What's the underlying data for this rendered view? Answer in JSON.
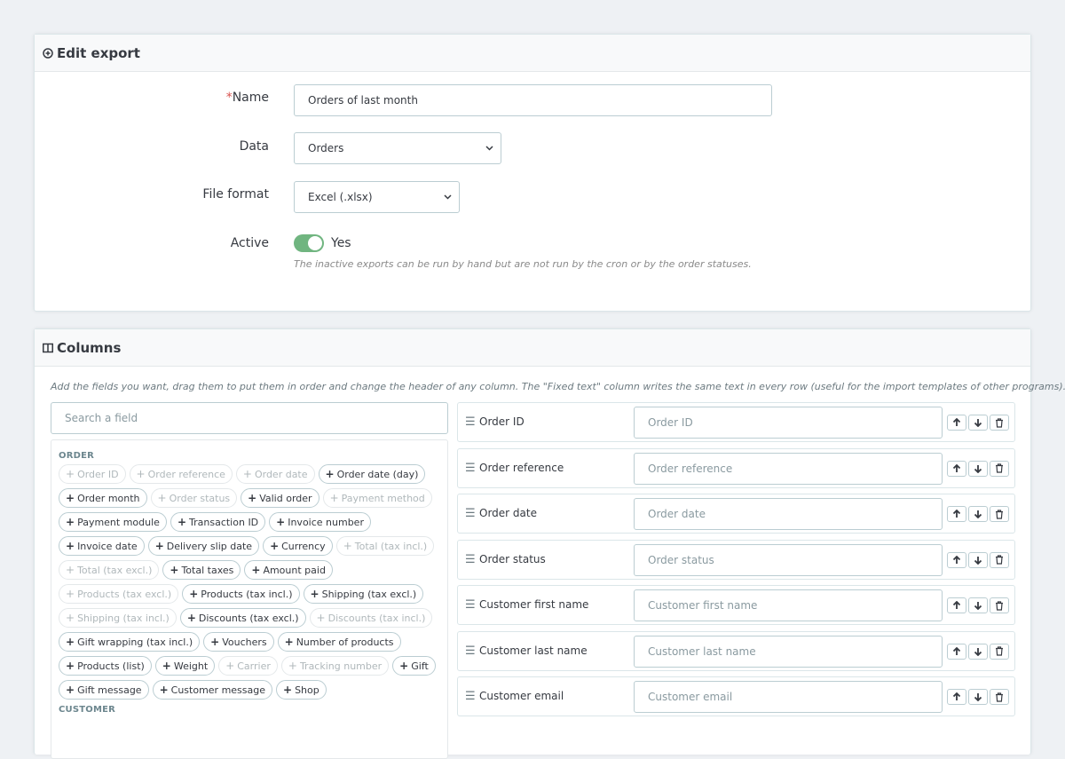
{
  "edit_panel": {
    "title": "Edit export",
    "name_label": "Name",
    "name_required_mark": "*",
    "name_value": "Orders of last month",
    "data_label": "Data",
    "data_value": "Orders",
    "format_label": "File format",
    "format_value": "Excel (.xlsx)",
    "active_label": "Active",
    "active_state": "Yes",
    "active_help": "The inactive exports can be run by hand but are not run by the cron or by the order statuses."
  },
  "columns_panel": {
    "title": "Columns",
    "help": "Add the fields you want, drag them to put them in order and change the header of any column. The \"Fixed text\" column writes the same text in every row (useful for the import templates of other programs).",
    "search_placeholder": "Search a field",
    "groups": [
      {
        "name": "ORDER",
        "fields": [
          {
            "label": "Order ID",
            "used": true
          },
          {
            "label": "Order reference",
            "used": true
          },
          {
            "label": "Order date",
            "used": true
          },
          {
            "label": "Order date (day)",
            "used": false
          },
          {
            "label": "Order month",
            "used": false
          },
          {
            "label": "Order status",
            "used": true
          },
          {
            "label": "Valid order",
            "used": false
          },
          {
            "label": "Payment method",
            "used": true
          },
          {
            "label": "Payment module",
            "used": false
          },
          {
            "label": "Transaction ID",
            "used": false
          },
          {
            "label": "Invoice number",
            "used": false
          },
          {
            "label": "Invoice date",
            "used": false
          },
          {
            "label": "Delivery slip date",
            "used": false
          },
          {
            "label": "Currency",
            "used": false
          },
          {
            "label": "Total (tax incl.)",
            "used": true
          },
          {
            "label": "Total (tax excl.)",
            "used": true
          },
          {
            "label": "Total taxes",
            "used": false
          },
          {
            "label": "Amount paid",
            "used": false
          },
          {
            "label": "Products (tax excl.)",
            "used": true
          },
          {
            "label": "Products (tax incl.)",
            "used": false
          },
          {
            "label": "Shipping (tax excl.)",
            "used": false
          },
          {
            "label": "Shipping (tax incl.)",
            "used": true
          },
          {
            "label": "Discounts (tax excl.)",
            "used": false
          },
          {
            "label": "Discounts (tax incl.)",
            "used": true
          },
          {
            "label": "Gift wrapping (tax incl.)",
            "used": false
          },
          {
            "label": "Vouchers",
            "used": false
          },
          {
            "label": "Number of products",
            "used": false
          },
          {
            "label": "Products (list)",
            "used": false
          },
          {
            "label": "Weight",
            "used": false
          },
          {
            "label": "Carrier",
            "used": true
          },
          {
            "label": "Tracking number",
            "used": true
          },
          {
            "label": "Gift",
            "used": false
          },
          {
            "label": "Gift message",
            "used": false
          },
          {
            "label": "Customer message",
            "used": false
          },
          {
            "label": "Shop",
            "used": false
          }
        ]
      },
      {
        "name": "CUSTOMER",
        "fields": []
      }
    ],
    "columns": [
      {
        "name": "Order ID",
        "placeholder": "Order ID"
      },
      {
        "name": "Order reference",
        "placeholder": "Order reference"
      },
      {
        "name": "Order date",
        "placeholder": "Order date"
      },
      {
        "name": "Order status",
        "placeholder": "Order status"
      },
      {
        "name": "Customer first name",
        "placeholder": "Customer first name"
      },
      {
        "name": "Customer last name",
        "placeholder": "Customer last name"
      },
      {
        "name": "Customer email",
        "placeholder": "Customer email"
      }
    ]
  },
  "colors": {
    "toggle_on": "#70b580",
    "required": "#d9534f"
  }
}
